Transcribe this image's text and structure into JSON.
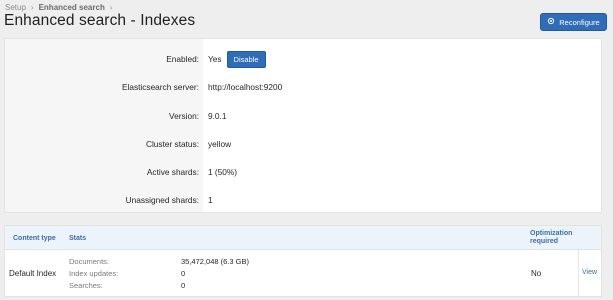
{
  "breadcrumb": {
    "root": "Setup",
    "current": "Enhanced search"
  },
  "page": {
    "title": "Enhanced search - Indexes",
    "reconfigure_label": "Reconfigure"
  },
  "details": {
    "enabled_label": "Enabled:",
    "enabled_value": "Yes",
    "disable_label": "Disable",
    "server_label": "Elasticsearch server:",
    "server_value": "http://localhost:9200",
    "version_label": "Version:",
    "version_value": "9.0.1",
    "cluster_label": "Cluster status:",
    "cluster_value": "yellow",
    "active_label": "Active shards:",
    "active_value": "1 (50%)",
    "unassigned_label": "Unassigned shards:",
    "unassigned_value": "1"
  },
  "table": {
    "headers": {
      "content_type": "Content type",
      "stats": "Stats",
      "optimization_line1": "Optimization",
      "optimization_line2": "required"
    },
    "rows": [
      {
        "content_type": "Default Index",
        "documents_label": "Documents:",
        "documents_value": "35,472,048 (6.3 GB)",
        "updates_label": "Index updates:",
        "updates_value": "0",
        "searches_label": "Searches:",
        "searches_value": "0",
        "optimization": "No",
        "action": "View"
      }
    ]
  },
  "colors": {
    "accent": "#2f6db8",
    "header_bg": "#ecf3fa",
    "header_text": "#3b6ea8"
  },
  "icons": {
    "reconfigure": "gear-icon",
    "breadcrumb_sep": "chevron-right-icon"
  }
}
